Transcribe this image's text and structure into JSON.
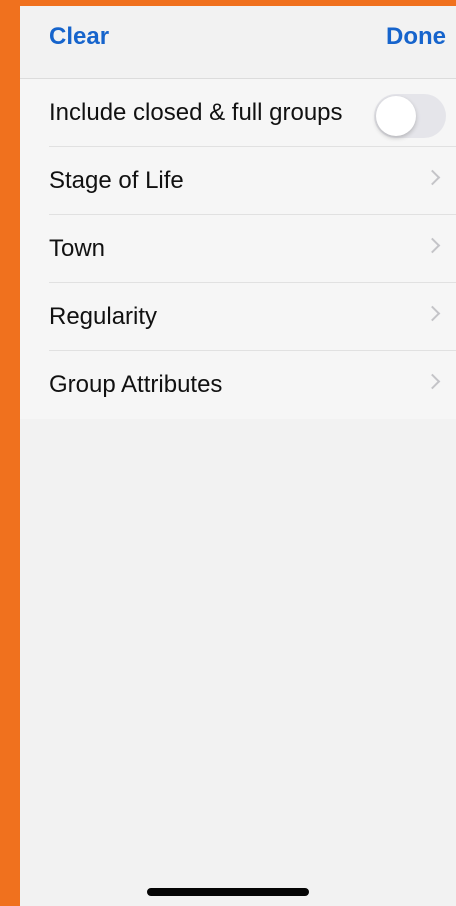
{
  "nav": {
    "clear_label": "Clear",
    "done_label": "Done"
  },
  "filters": {
    "toggle_row": {
      "label": "Include closed & full groups",
      "enabled": false
    },
    "items": [
      {
        "label": "Stage of Life",
        "icon": "chevron-right-icon"
      },
      {
        "label": "Town",
        "icon": "chevron-right-icon"
      },
      {
        "label": "Regularity",
        "icon": "chevron-right-icon"
      },
      {
        "label": "Group Attributes",
        "icon": "chevron-right-icon"
      }
    ]
  },
  "colors": {
    "accent": "#1664cc",
    "frame": "#f0711e",
    "background": "#f2f2f2"
  }
}
